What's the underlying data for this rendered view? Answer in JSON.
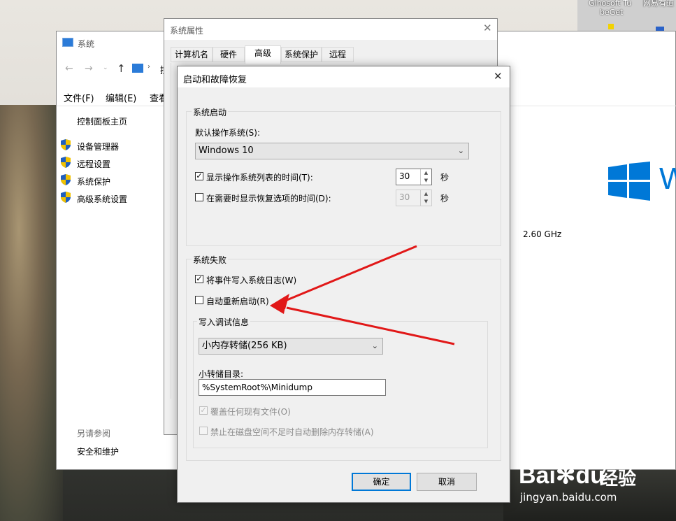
{
  "desktop": {
    "icons": [
      {
        "label_line1": "Gihosoft Tu",
        "label_line2": "beGet"
      },
      {
        "label_line1": "网易有道"
      }
    ]
  },
  "system_window": {
    "title": "系统",
    "address_fragment": "控",
    "menu": [
      "文件(F)",
      "编辑(E)",
      "查看"
    ],
    "sidebar": {
      "home": "控制面板主页",
      "links": [
        "设备管理器",
        "远程设置",
        "系统保护",
        "高级系统设置"
      ],
      "see_also_title": "另请参阅",
      "see_also_link": "安全和维护"
    },
    "cpu_speed": "2.60 GHz",
    "cpu_speed_prefix": "z",
    "logo_text": "W"
  },
  "properties_window": {
    "title": "系统属性",
    "tabs": [
      "计算机名",
      "硬件",
      "高级",
      "系统保护",
      "远程"
    ],
    "active_tab": "高级"
  },
  "dialog": {
    "title": "启动和故障恢复",
    "startup_group": {
      "label": "系统启动",
      "default_os_label": "默认操作系统(S):",
      "default_os_value": "Windows 10",
      "show_list": {
        "label": "显示操作系统列表的时间(T):",
        "checked": true,
        "value": "30",
        "unit": "秒"
      },
      "show_recovery": {
        "label": "在需要时显示恢复选项的时间(D):",
        "checked": false,
        "value": "30",
        "unit": "秒"
      }
    },
    "failure_group": {
      "label": "系统失败",
      "write_event": {
        "label": "将事件写入系统日志(W)",
        "checked": true
      },
      "auto_restart": {
        "label": "自动重新启动(R)",
        "checked": false
      },
      "debug_group": {
        "label": "写入调试信息",
        "dump_type": "小内存转储(256 KB)",
        "dump_dir_label": "小转储目录:",
        "dump_dir_value": "%SystemRoot%\\Minidump",
        "overwrite": {
          "label": "覆盖任何现有文件(O)",
          "checked": true
        },
        "disable_auto_delete": {
          "label": "禁止在磁盘空间不足时自动删除内存转储(A)",
          "checked": false
        }
      }
    },
    "ok_label": "确定",
    "cancel_label": "取消"
  },
  "watermark": {
    "brand": "Bai",
    "brand_tail": "du",
    "cn": "经验",
    "url": "jingyan.baidu.com"
  },
  "colors": {
    "arrow": "#e11818",
    "win_blue": "#0078d7",
    "shield_blue": "#1f5fbf",
    "shield_yellow": "#f2c200"
  }
}
